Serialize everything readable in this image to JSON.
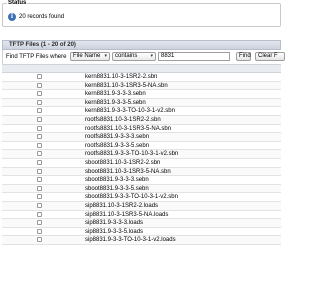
{
  "status": {
    "legend": "Status",
    "message": "20 records found",
    "icon": "info-icon"
  },
  "panel": {
    "title": "TFTP Files",
    "range": "(1 - 20 of 20)"
  },
  "find": {
    "label": "Find TFTP Files where",
    "field": "File Name",
    "operator": "contains",
    "value": "8831",
    "find_button": "Find",
    "clear_button": "Clear F"
  },
  "files": [
    "kern8831.10-3-1SR2-2.sbn",
    "kern8831.10-3-1SR3-5-NA.sbn",
    "kern8831.9-3-3-3.sebn",
    "kern8831.9-3-3-5.sebn",
    "kern8831.9-3-3-TO-10-3-1-v2.sbn",
    "rootfs8831.10-3-1SR2-2.sbn",
    "rootfs8831.10-3-1SR3-5-NA.sbn",
    "rootfs8831.9-3-3-3.sebn",
    "rootfs8831.9-3-3-5.sebn",
    "rootfs8831.9-3-3-TO-10-3-1-v2.sbn",
    "sboot8831.10-3-1SR2-2.sbn",
    "sboot8831.10-3-1SR3-5-NA.sbn",
    "sboot8831.9-3-3-3.sebn",
    "sboot8831.9-3-3-5.sebn",
    "sboot8831.9-3-3-TO-10-3-1-v2.sbn",
    "sip8831.10-3-1SR2-2.loads",
    "sip8831.10-3-1SR3-5-NA.loads",
    "sip8831.9-3-3-3.loads",
    "sip8831.9-3-3-5.loads",
    "sip8831.9-3-3-TO-10-3-1-v2.loads"
  ]
}
